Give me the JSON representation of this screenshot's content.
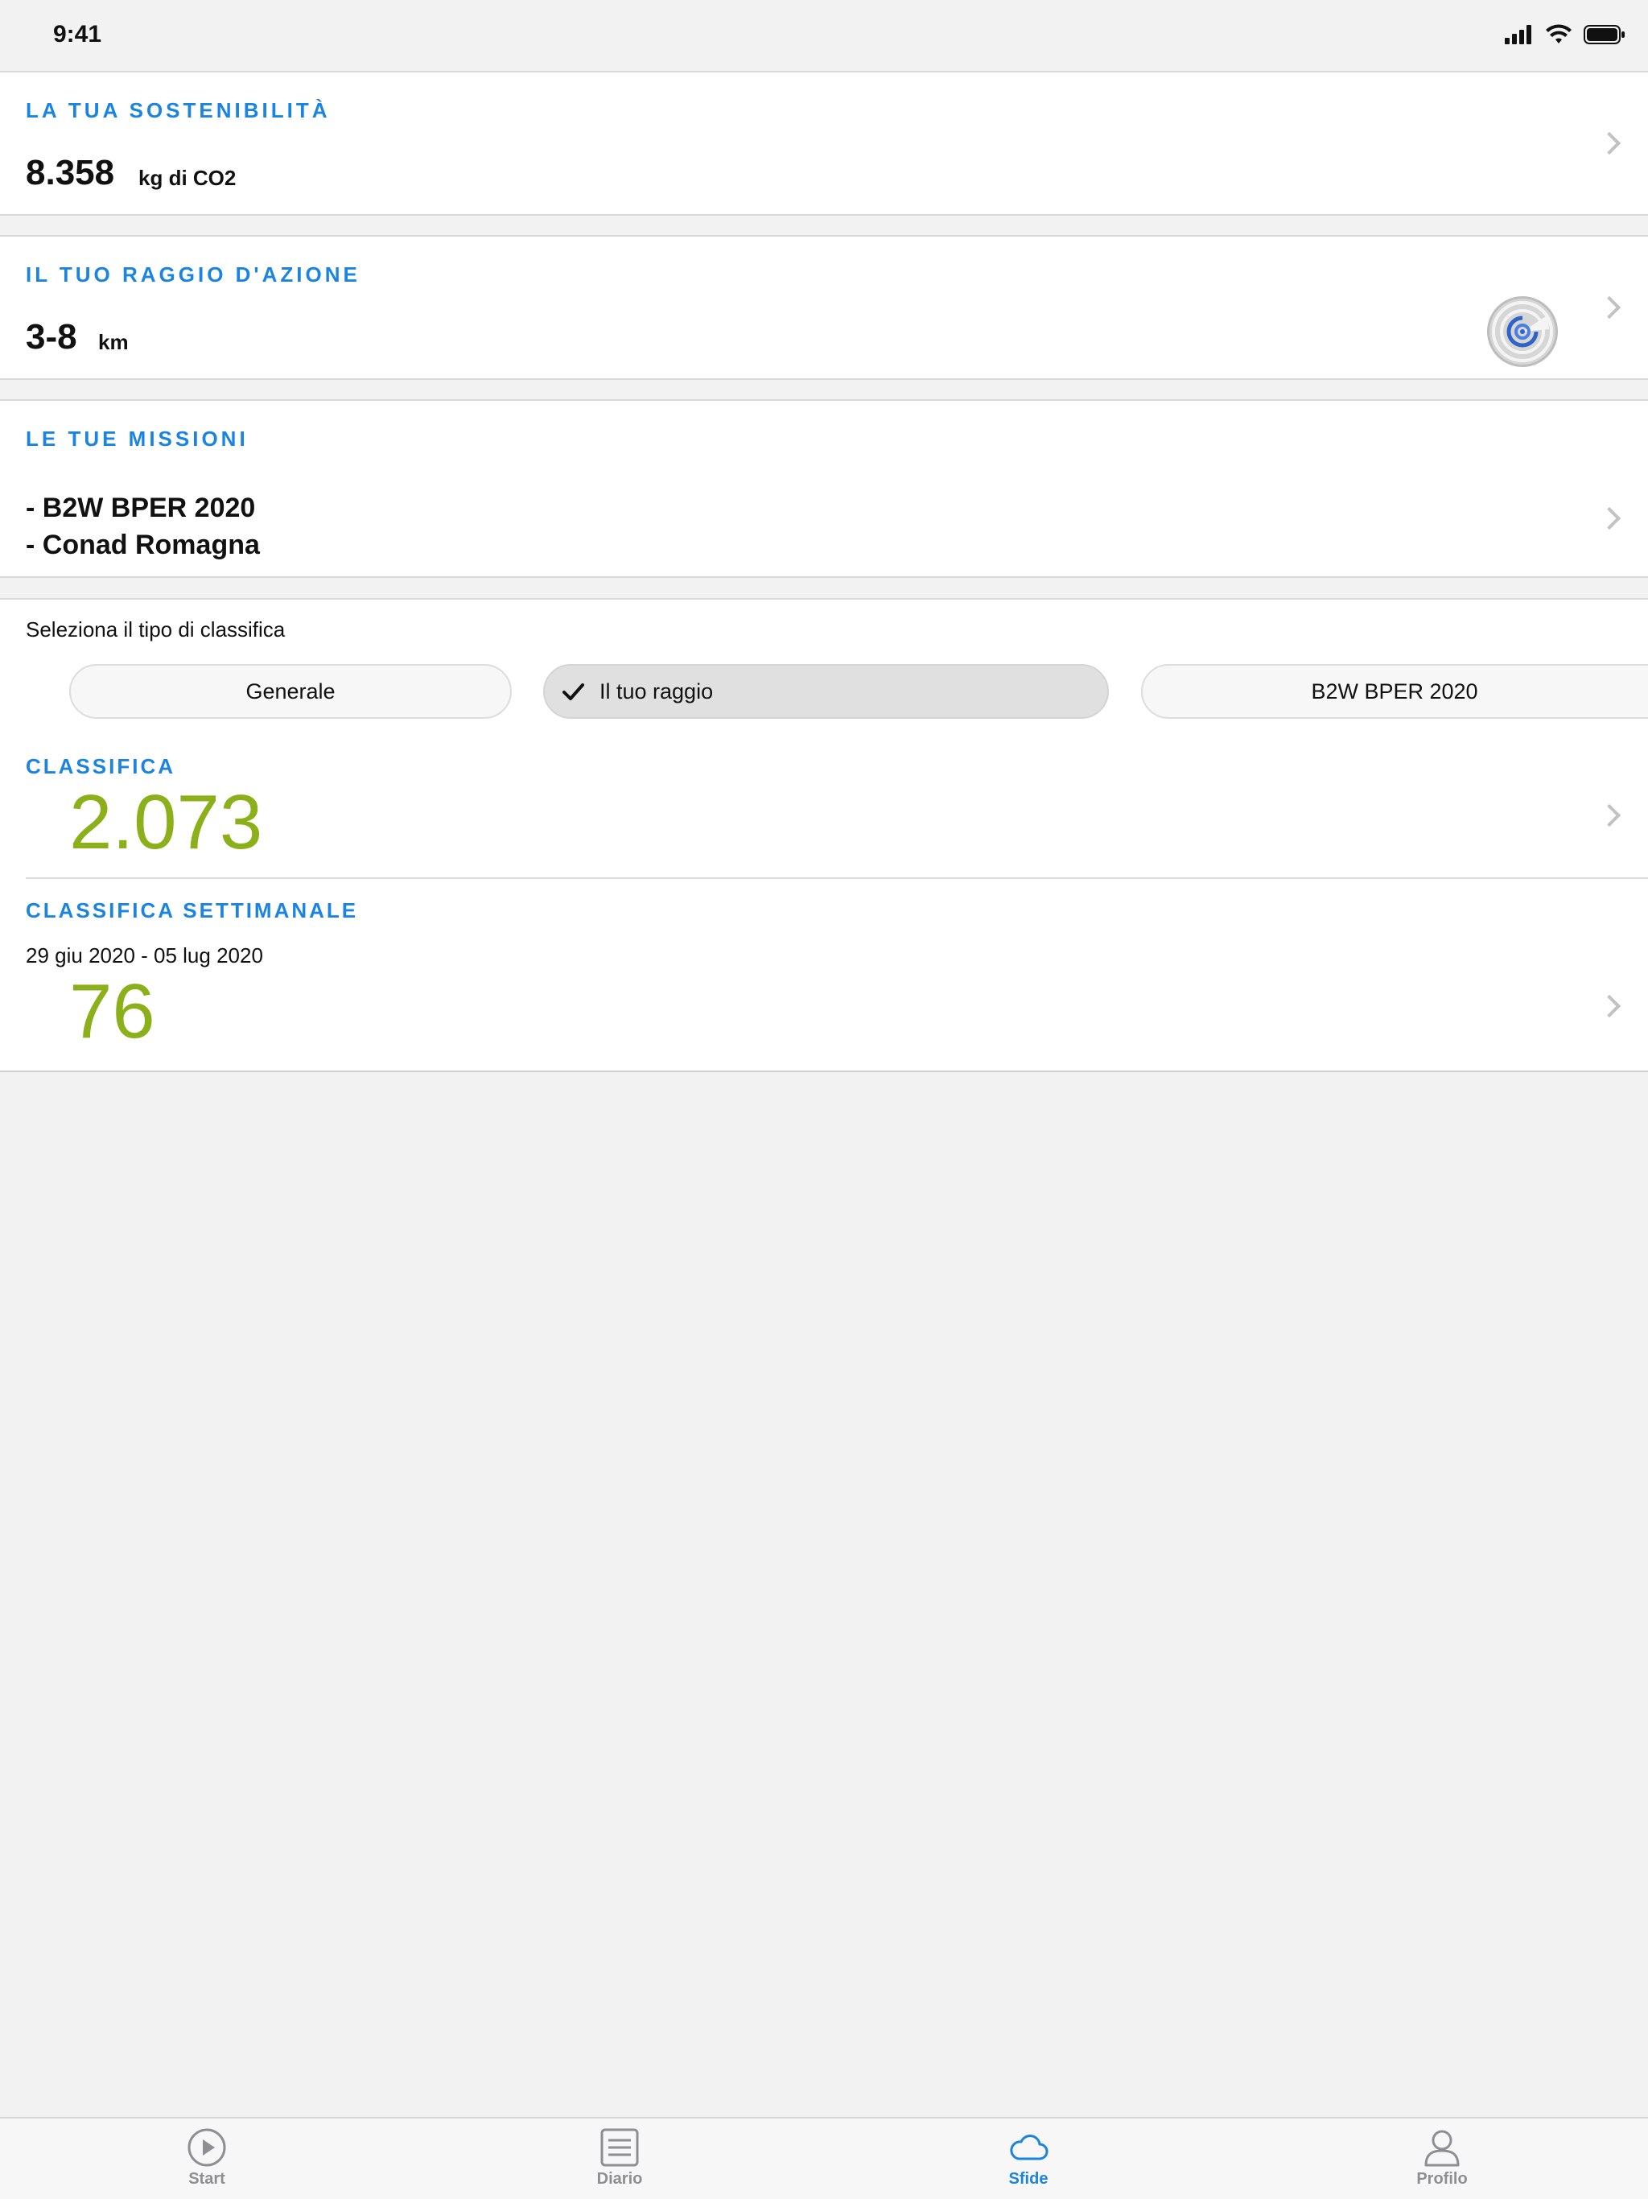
{
  "status_bar": {
    "time": "9:41"
  },
  "sustainability": {
    "label": "LA TUA SOSTENIBILITÀ",
    "value": "8.358",
    "unit": "kg di CO2"
  },
  "action_radius": {
    "label": "IL TUO RAGGIO D'AZIONE",
    "value": "3-8",
    "unit": "km"
  },
  "missions": {
    "label": "LE TUE MISSIONI",
    "items": [
      "- B2W BPER 2020",
      "- Conad Romagna"
    ]
  },
  "leaderboard": {
    "select_label": "Seleziona il tipo di classifica",
    "segments": [
      {
        "label": "Generale",
        "selected": false
      },
      {
        "label": "Il tuo raggio",
        "selected": true
      },
      {
        "label": "B2W BPER 2020",
        "selected": false
      }
    ],
    "overall": {
      "label": "CLASSIFICA",
      "value": "2.073"
    },
    "weekly": {
      "label": "CLASSIFICA SETTIMANALE",
      "date_range": "29 giu 2020 - 05 lug 2020",
      "value": "76"
    }
  },
  "tab_bar": {
    "tabs": [
      {
        "label": "Start",
        "icon": "play-icon",
        "active": false
      },
      {
        "label": "Diario",
        "icon": "diary-icon",
        "active": false
      },
      {
        "label": "Sfide",
        "icon": "cloud-icon",
        "active": true
      },
      {
        "label": "Profilo",
        "icon": "profile-icon",
        "active": false
      }
    ]
  },
  "colors": {
    "accent": "#1a84e0",
    "rank_green": "#8bb01a",
    "background": "#f2f2f2"
  }
}
